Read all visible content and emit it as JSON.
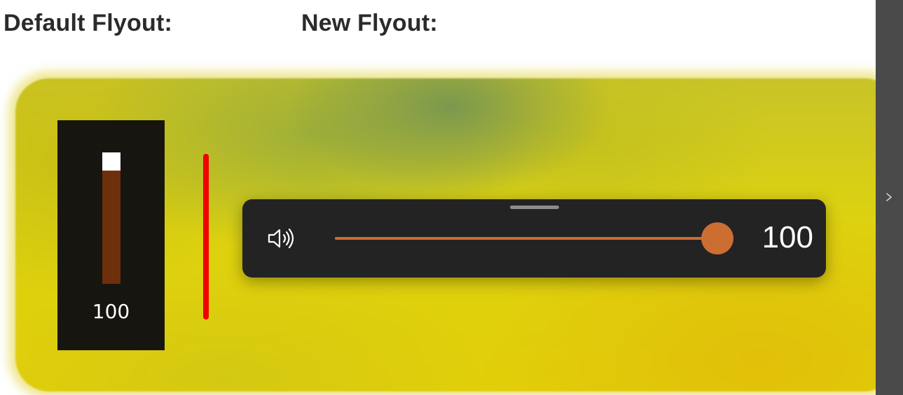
{
  "headings": {
    "default": "Default Flyout:",
    "new": "New Flyout:"
  },
  "default_flyout": {
    "volume_label": "100",
    "volume_level": 1.0,
    "track_color": "#6e2f0c",
    "thumb_color": "#ffffff",
    "background_color": "#17150f"
  },
  "divider": {
    "color": "#f00000"
  },
  "new_flyout": {
    "speaker_icon": "speaker-volume-icon",
    "volume_label": "100",
    "volume_level": 1.0,
    "accent_color": "#cc6d32",
    "background_color": "#232323"
  },
  "side_panel": {
    "expand_icon": "chevron-right-icon"
  }
}
